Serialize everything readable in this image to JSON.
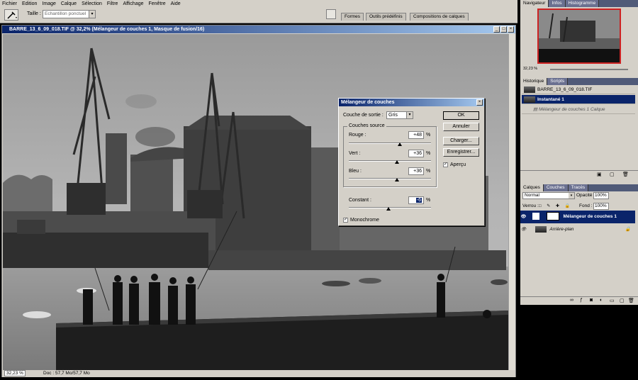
{
  "menu": [
    "Fichier",
    "Edition",
    "Image",
    "Calque",
    "Sélection",
    "Filtre",
    "Affichage",
    "Fenêtre",
    "Aide"
  ],
  "options": {
    "taille_label": "Taille :",
    "sample_value": "Echantillon ponctuel",
    "tabs": [
      "Formes",
      "Outils prédéfinis",
      "Compositions de calques"
    ]
  },
  "document": {
    "title": "BARRE_13_6_09_018.TIF @ 32,2% (Mélangeur de couches 1, Masque de fusion/16)",
    "zoom": "32,23 %",
    "doc_info": "Doc : 57,7 Mo/57,7 Mo"
  },
  "dialog": {
    "title": "Mélangeur de couches",
    "output_label": "Couche de sortie :",
    "output_value": "Gris",
    "source_group": "Couches source",
    "channels": [
      {
        "label": "Rouge :",
        "value": "+48",
        "level": 48
      },
      {
        "label": "Vert :",
        "value": "+36",
        "level": 36
      },
      {
        "label": "Bleu :",
        "value": "+36",
        "level": 36
      }
    ],
    "constant_label": "Constant :",
    "constant_value": "-6",
    "constant_level": -6,
    "percent": "%",
    "monochrome_label": "Monochrome",
    "preview_label": "Aperçu",
    "buttons": {
      "ok": "OK",
      "cancel": "Annuler",
      "load": "Charger...",
      "save": "Enregistrer..."
    }
  },
  "navigator": {
    "tabs": [
      "Navigateur",
      "Infos",
      "Histogramme"
    ],
    "zoom": "32,23 %"
  },
  "history": {
    "tabs": [
      "Historique",
      "Scripts"
    ],
    "items": [
      {
        "label": "BARRE_13_6_09_018.TIF"
      },
      {
        "label": "Instantané 1",
        "selected": true
      },
      {
        "label": "Mélangeur de couches 1 Calque"
      }
    ]
  },
  "layers": {
    "tabs": [
      "Calques",
      "Couches",
      "Tracés"
    ],
    "blend_mode": "Normal",
    "opacity_label": "Opacité :",
    "opacity_value": "100%",
    "lock_label": "Verrou :",
    "fill_label": "Fond :",
    "fill_value": "100%",
    "items": [
      {
        "label": "Mélangeur de couches 1",
        "selected": true
      },
      {
        "label": "Arrière-plan"
      }
    ]
  }
}
